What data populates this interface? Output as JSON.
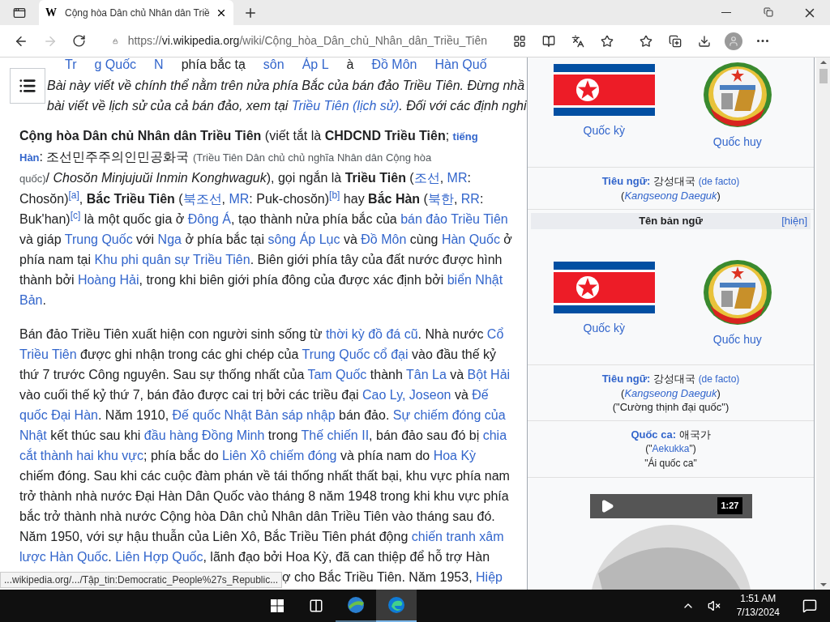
{
  "browser": {
    "favicon": "W",
    "tab_title": "Cộng hòa Dân chủ Nhân dân Triề",
    "url_scheme": "https://",
    "url_host": "vi.wikipedia.org",
    "url_path": "/wiki/Cộng_hòa_Dân_chủ_Nhân_dân_Triều_Tiên",
    "forward_disabled": true
  },
  "scrolled_line": [
    {
      "kind": "l",
      "t": "Tr"
    },
    {
      "kind": "l",
      "t": "g Quốc"
    },
    {
      "kind": "l",
      "t": "N"
    },
    {
      "kind": "t",
      "t": "phía bắc tạ"
    },
    {
      "kind": "l",
      "t": "sôn"
    },
    {
      "kind": "l",
      "t": "Áp L"
    },
    {
      "kind": "t",
      "t": "à"
    },
    {
      "kind": "l",
      "t": "Đồ Môn"
    },
    {
      "kind": "l",
      "t": "Hàn Quố"
    }
  ],
  "hatnote": [
    [
      {
        "kind": "i",
        "t": "Bài này viết về chính thể nằm trên nửa phía Bắc của bán đảo Triều Tiên. Đừng nhầ"
      }
    ],
    [
      {
        "kind": "i",
        "t": "bài viết về lịch sử của cả bán đảo, xem tại "
      },
      {
        "kind": "il",
        "t": "Triều Tiên (lịch sử)"
      },
      {
        "kind": "i",
        "t": ". Đối với các định nghi"
      }
    ]
  ],
  "paragraphs": [
    {
      "lines": [
        [
          {
            "kind": "b",
            "t": "Cộng hòa Dân chủ Nhân dân Triều Tiên"
          },
          {
            "kind": "t",
            "t": " (viết tắt là "
          },
          {
            "kind": "b",
            "t": "CHDCND Triều Tiên"
          },
          {
            "kind": "t",
            "t": "; "
          },
          {
            "kind": "sbl",
            "t": "tiếng"
          }
        ],
        [
          {
            "kind": "sbl",
            "t": "Hàn"
          },
          {
            "kind": "t",
            "t": ": 조선민주주의인민공화국 "
          },
          {
            "kind": "s",
            "t": "(Triều Tiên Dân chủ chủ nghĩa Nhân dân Cộng hòa"
          }
        ],
        [
          {
            "kind": "s",
            "t": "quốc)"
          },
          {
            "kind": "t",
            "t": "/ "
          },
          {
            "kind": "i",
            "t": "Chosŏn Minjujuŭi Inmin Konghwaguk"
          },
          {
            "kind": "t",
            "t": "), gọi ngắn là "
          },
          {
            "kind": "b",
            "t": "Triều Tiên"
          },
          {
            "kind": "t",
            "t": " ("
          },
          {
            "kind": "l",
            "t": "조선"
          },
          {
            "kind": "t",
            "t": ", "
          },
          {
            "kind": "l",
            "t": "MR"
          },
          {
            "kind": "t",
            "t": ":"
          }
        ],
        [
          {
            "kind": "t",
            "t": "Chosŏn)"
          },
          {
            "kind": "sup",
            "t": "[a]"
          },
          {
            "kind": "t",
            "t": ", "
          },
          {
            "kind": "b",
            "t": "Bắc Triều Tiên"
          },
          {
            "kind": "t",
            "t": " ("
          },
          {
            "kind": "l",
            "t": "북조선"
          },
          {
            "kind": "t",
            "t": ", "
          },
          {
            "kind": "l",
            "t": "MR"
          },
          {
            "kind": "t",
            "t": ": Puk-chosŏn)"
          },
          {
            "kind": "sup",
            "t": "[b]"
          },
          {
            "kind": "t",
            "t": " hay "
          },
          {
            "kind": "b",
            "t": "Bắc Hàn"
          },
          {
            "kind": "t",
            "t": " ("
          },
          {
            "kind": "l",
            "t": "북한"
          },
          {
            "kind": "t",
            "t": ", "
          },
          {
            "kind": "l",
            "t": "RR"
          },
          {
            "kind": "t",
            "t": ":"
          }
        ],
        [
          {
            "kind": "t",
            "t": "Buk'han)"
          },
          {
            "kind": "sup",
            "t": "[c]"
          },
          {
            "kind": "t",
            "t": " là một quốc gia ở "
          },
          {
            "kind": "l",
            "t": "Đông Á"
          },
          {
            "kind": "t",
            "t": ", tạo thành nửa phía bắc của "
          },
          {
            "kind": "l",
            "t": "bán đảo Triều Tiên"
          }
        ],
        [
          {
            "kind": "t",
            "t": "và giáp "
          },
          {
            "kind": "l",
            "t": "Trung Quốc"
          },
          {
            "kind": "t",
            "t": " với "
          },
          {
            "kind": "l",
            "t": "Nga"
          },
          {
            "kind": "t",
            "t": " ở phía bắc tại "
          },
          {
            "kind": "l",
            "t": "sông Áp Lục"
          },
          {
            "kind": "t",
            "t": " và "
          },
          {
            "kind": "l",
            "t": "Đồ Môn"
          },
          {
            "kind": "t",
            "t": " cùng "
          },
          {
            "kind": "l",
            "t": "Hàn Quốc"
          },
          {
            "kind": "t",
            "t": " ở"
          }
        ],
        [
          {
            "kind": "t",
            "t": "phía nam tại "
          },
          {
            "kind": "l",
            "t": "Khu phi quân sự Triều Tiên"
          },
          {
            "kind": "t",
            "t": ". Biên giới phía tây của đất nước được hình"
          }
        ],
        [
          {
            "kind": "t",
            "t": "thành bởi "
          },
          {
            "kind": "l",
            "t": "Hoàng Hải"
          },
          {
            "kind": "t",
            "t": ", trong khi biên giới phía đông của được xác định bởi "
          },
          {
            "kind": "l",
            "t": "biển Nhật"
          }
        ],
        [
          {
            "kind": "l",
            "t": "Bản"
          },
          {
            "kind": "t",
            "t": "."
          }
        ]
      ]
    },
    {
      "lines": [
        [
          {
            "kind": "t",
            "t": "Bán đảo Triều Tiên xuất hiện con người sinh sống từ "
          },
          {
            "kind": "l",
            "t": "thời kỳ đồ đá cũ"
          },
          {
            "kind": "t",
            "t": ". Nhà nước "
          },
          {
            "kind": "l",
            "t": "Cổ"
          }
        ],
        [
          {
            "kind": "l",
            "t": "Triều Tiên"
          },
          {
            "kind": "t",
            "t": " được ghi nhận trong các ghi chép của "
          },
          {
            "kind": "l",
            "t": "Trung Quốc cổ đại"
          },
          {
            "kind": "t",
            "t": " vào đầu thế kỷ"
          }
        ],
        [
          {
            "kind": "t",
            "t": "thứ 7 trước Công nguyên. Sau sự thống nhất của "
          },
          {
            "kind": "l",
            "t": "Tam Quốc"
          },
          {
            "kind": "t",
            "t": " thành "
          },
          {
            "kind": "l",
            "t": "Tân La"
          },
          {
            "kind": "t",
            "t": " và "
          },
          {
            "kind": "l",
            "t": "Bột Hải"
          }
        ],
        [
          {
            "kind": "t",
            "t": "vào cuối thế kỷ thứ 7, bán đảo được cai trị bởi các triều đại "
          },
          {
            "kind": "l",
            "t": "Cao Ly, Joseon"
          },
          {
            "kind": "t",
            "t": " và "
          },
          {
            "kind": "l",
            "t": "Đế"
          }
        ],
        [
          {
            "kind": "l",
            "t": "quốc Đại Hàn"
          },
          {
            "kind": "t",
            "t": ". Năm 1910, "
          },
          {
            "kind": "l",
            "t": "Đế quốc Nhật Bản sáp nhập"
          },
          {
            "kind": "t",
            "t": " bán đảo. "
          },
          {
            "kind": "l",
            "t": "Sự chiếm đóng của"
          }
        ],
        [
          {
            "kind": "l",
            "t": "Nhật"
          },
          {
            "kind": "t",
            "t": " kết thúc sau khi "
          },
          {
            "kind": "l",
            "t": "đầu hàng Đồng Minh"
          },
          {
            "kind": "t",
            "t": " trong "
          },
          {
            "kind": "l",
            "t": "Thế chiến II"
          },
          {
            "kind": "t",
            "t": ", bán đảo sau đó bị "
          },
          {
            "kind": "l",
            "t": "chia"
          }
        ],
        [
          {
            "kind": "l",
            "t": "cắt thành hai khu vực"
          },
          {
            "kind": "t",
            "t": "; phía bắc do "
          },
          {
            "kind": "l",
            "t": "Liên Xô chiếm đóng"
          },
          {
            "kind": "t",
            "t": " và phía nam do "
          },
          {
            "kind": "l",
            "t": "Hoa Kỳ"
          }
        ],
        [
          {
            "kind": "t",
            "t": "chiếm đóng. Sau khi các cuộc đàm phán về tái thống nhất thất bại, khu vực phía nam"
          }
        ],
        [
          {
            "kind": "t",
            "t": "trở thành nhà nước Đại Hàn Dân Quốc vào tháng 8 năm 1948 trong khi khu vực phía"
          }
        ],
        [
          {
            "kind": "t",
            "t": "bắc trở thành nhà nước Cộng hòa Dân chủ Nhân dân Triều Tiên vào tháng sau đó."
          }
        ],
        [
          {
            "kind": "t",
            "t": "Năm 1950, với sự hậu thuẫn của Liên Xô, Bắc Triều Tiên phát động "
          },
          {
            "kind": "l",
            "t": "chiến tranh xâm"
          }
        ],
        [
          {
            "kind": "l",
            "t": "lược Hàn Quốc"
          },
          {
            "kind": "t",
            "t": ". "
          },
          {
            "kind": "l",
            "t": "Liên Hợp Quốc"
          },
          {
            "kind": "t",
            "t": ", lãnh đạo bởi Hoa Kỳ, đã can thiệp để hỗ trợ Hàn"
          }
        ]
      ],
      "obscured_tail": [
        {
          "kind": "t",
          "t": "ợ cho Bắc Triều Tiên. Năm 1953, "
        },
        {
          "kind": "l",
          "t": "Hiệp"
        }
      ]
    }
  ],
  "infobox": [
    {
      "kind": "symbols",
      "flag_caption": "Quốc kỳ",
      "emblem_caption": "Quốc huy"
    },
    {
      "kind": "text",
      "lines": [
        [
          {
            "kind": "lb",
            "t": "Tiêu ngữ:"
          },
          {
            "kind": "t",
            "t": " 강성대국 "
          },
          {
            "kind": "sl",
            "t": "(de facto)"
          }
        ],
        [
          {
            "kind": "t",
            "t": "("
          },
          {
            "kind": "il",
            "t": "Kangseong Daeguk"
          },
          {
            "kind": "t",
            "t": ")"
          }
        ]
      ]
    },
    {
      "kind": "header",
      "title": "Tên bản ngữ",
      "toggle": "[hiện]"
    },
    {
      "kind": "symbols",
      "flag_caption": "Quốc kỳ",
      "emblem_caption": "Quốc huy"
    },
    {
      "kind": "text",
      "lines": [
        [
          {
            "kind": "lb",
            "t": "Tiêu ngữ:"
          },
          {
            "kind": "t",
            "t": " 강성대국 "
          },
          {
            "kind": "sl",
            "t": "(de facto)"
          }
        ],
        [
          {
            "kind": "t",
            "t": "("
          },
          {
            "kind": "il",
            "t": "Kangseong Daeguk"
          },
          {
            "kind": "t",
            "t": ")"
          }
        ],
        [
          {
            "kind": "t",
            "t": "(\"Cường thịnh đại quốc\")"
          }
        ]
      ]
    },
    {
      "kind": "text",
      "lines": [
        [
          {
            "kind": "lb",
            "t": "Quốc ca:"
          },
          {
            "kind": "t",
            "t": " 애국가"
          }
        ],
        [
          {
            "kind": "st",
            "t": "(\""
          },
          {
            "kind": "sl",
            "t": "Aekukka"
          },
          {
            "kind": "st",
            "t": "\")"
          }
        ],
        [
          {
            "kind": "st",
            "t": "\"Ái quốc ca\""
          }
        ]
      ]
    },
    {
      "kind": "player",
      "duration": "1:27"
    },
    {
      "kind": "map"
    }
  ],
  "status_text": "...wikipedia.org/.../Tập_tin:Democratic_People%27s_Republic...",
  "taskbar": {
    "apps": [
      {
        "selected": false
      },
      {
        "selected": true
      }
    ],
    "time": "1:51 AM",
    "date": "7/13/2024"
  }
}
